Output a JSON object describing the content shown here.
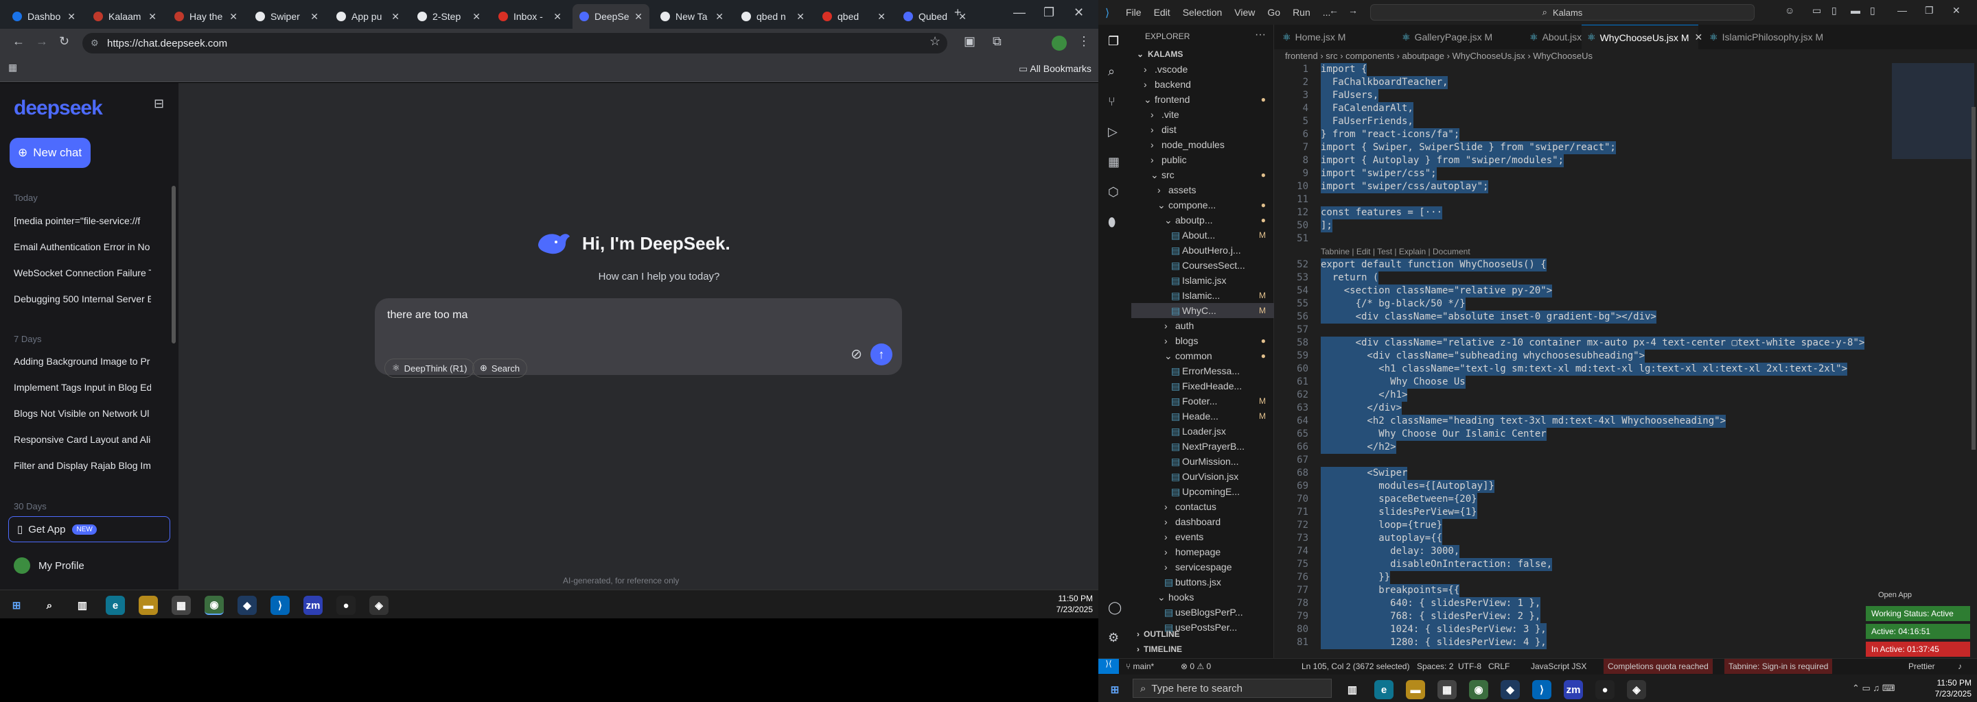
{
  "browser": {
    "tabs": [
      {
        "label": "Dashbo",
        "color": "#1a73e8"
      },
      {
        "label": "Kalaam",
        "color": "#c0392b"
      },
      {
        "label": "Hay the",
        "color": "#c0392b"
      },
      {
        "label": "Swiper",
        "color": "#e8eaed"
      },
      {
        "label": "App pu",
        "color": "#e8eaed"
      },
      {
        "label": "2-Step",
        "color": "#e8eaed"
      },
      {
        "label": "Inbox -",
        "color": "#d93025"
      },
      {
        "label": "DeepSe",
        "color": "#4d6bfe"
      },
      {
        "label": "New Ta",
        "color": "#e8eaed"
      },
      {
        "label": "qbed n",
        "color": "#e8eaed"
      },
      {
        "label": "qbed",
        "color": "#d93025"
      },
      {
        "label": "Qubed",
        "color": "#4d6bfe"
      }
    ],
    "url": "https://chat.deepseek.com",
    "all_bookmarks": "All Bookmarks"
  },
  "deepseek": {
    "logo": "deepseek",
    "new_chat": "New chat",
    "groups": {
      "today": "Today",
      "days7": "7 Days",
      "days30": "30 Days"
    },
    "history_today": [
      "[media pointer=\"file-service://f",
      "Email Authentication Error in No",
      "WebSocket Connection Failure Tr",
      "Debugging 500 Internal Server E"
    ],
    "history_7days": [
      "Adding Background Image to Pr",
      "Implement Tags Input in Blog Ed",
      "Blogs Not Visible on Network Ul",
      "Responsive Card Layout and Alig",
      "Filter and Display Rajab Blog Ima"
    ],
    "get_app": "Get App",
    "new_badge": "NEW",
    "profile": "My Profile",
    "greeting": "Hi, I'm DeepSeek.",
    "subtitle": "How can I help you today?",
    "input_value": "there are too ma",
    "deepthink": "DeepThink (R1)",
    "search": "Search",
    "footer": "AI-generated, for reference only"
  },
  "taskbar_left": {
    "time": "11:50 PM",
    "date": "7/23/2025"
  },
  "vscode": {
    "menu": [
      "File",
      "Edit",
      "Selection",
      "View",
      "Go",
      "Run",
      "..."
    ],
    "search": "Kalams",
    "explorer_title": "EXPLORER",
    "tree": [
      {
        "d": 0,
        "label": "KALAMS",
        "arrow": "⌄",
        "bold": true
      },
      {
        "d": 1,
        "label": ".vscode",
        "arrow": "›"
      },
      {
        "d": 1,
        "label": "backend",
        "arrow": "›"
      },
      {
        "d": 1,
        "label": "frontend",
        "arrow": "⌄",
        "mark": "●"
      },
      {
        "d": 2,
        "label": ".vite",
        "arrow": "›"
      },
      {
        "d": 2,
        "label": "dist",
        "arrow": "›"
      },
      {
        "d": 2,
        "label": "node_modules",
        "arrow": "›"
      },
      {
        "d": 2,
        "label": "public",
        "arrow": "›"
      },
      {
        "d": 2,
        "label": "src",
        "arrow": "⌄",
        "mark": "●"
      },
      {
        "d": 3,
        "label": "assets",
        "arrow": "›"
      },
      {
        "d": 3,
        "label": "compone...",
        "arrow": "⌄",
        "mark": "●"
      },
      {
        "d": 4,
        "label": "aboutp...",
        "arrow": "⌄",
        "mark": "●"
      },
      {
        "d": 5,
        "label": "About...",
        "mark": "M"
      },
      {
        "d": 5,
        "label": "AboutHero.j..."
      },
      {
        "d": 5,
        "label": "CoursesSect..."
      },
      {
        "d": 5,
        "label": "Islamic.jsx"
      },
      {
        "d": 5,
        "label": "Islamic...",
        "mark": "M"
      },
      {
        "d": 5,
        "label": "WhyC...",
        "mark": "M",
        "active": true
      },
      {
        "d": 4,
        "label": "auth",
        "arrow": "›"
      },
      {
        "d": 4,
        "label": "blogs",
        "arrow": "›",
        "mark": "●"
      },
      {
        "d": 4,
        "label": "common",
        "arrow": "⌄",
        "mark": "●"
      },
      {
        "d": 5,
        "label": "ErrorMessa..."
      },
      {
        "d": 5,
        "label": "FixedHeade..."
      },
      {
        "d": 5,
        "label": "Footer...",
        "mark": "M"
      },
      {
        "d": 5,
        "label": "Heade...",
        "mark": "M"
      },
      {
        "d": 5,
        "label": "Loader.jsx"
      },
      {
        "d": 5,
        "label": "NextPrayerB..."
      },
      {
        "d": 5,
        "label": "OurMission..."
      },
      {
        "d": 5,
        "label": "OurVision.jsx"
      },
      {
        "d": 5,
        "label": "UpcomingE..."
      },
      {
        "d": 4,
        "label": "contactus",
        "arrow": "›"
      },
      {
        "d": 4,
        "label": "dashboard",
        "arrow": "›"
      },
      {
        "d": 4,
        "label": "events",
        "arrow": "›"
      },
      {
        "d": 4,
        "label": "homepage",
        "arrow": "›"
      },
      {
        "d": 4,
        "label": "servicespage",
        "arrow": "›"
      },
      {
        "d": 4,
        "label": "buttons.jsx"
      },
      {
        "d": 3,
        "label": "hooks",
        "arrow": "⌄"
      },
      {
        "d": 4,
        "label": "useBlogsPerP..."
      },
      {
        "d": 4,
        "label": "usePostsPer..."
      }
    ],
    "outline": "OUTLINE",
    "timeline": "TIMELINE",
    "tabs": [
      "Home.jsx M",
      "GalleryPage.jsx M",
      "About.jsx",
      "WhyChooseUs.jsx M",
      "IslamicPhilosophy.jsx M"
    ],
    "breadcrumb": "frontend › src › components › aboutpage › WhyChooseUs.jsx › WhyChooseUs",
    "lines": [
      [
        "1",
        "import {"
      ],
      [
        "2",
        "  FaChalkboardTeacher,"
      ],
      [
        "3",
        "  FaUsers,"
      ],
      [
        "4",
        "  FaCalendarAlt,"
      ],
      [
        "5",
        "  FaUserFriends,"
      ],
      [
        "6",
        "} from \"react-icons/fa\";"
      ],
      [
        "7",
        "import { Swiper, SwiperSlide } from \"swiper/react\";"
      ],
      [
        "8",
        "import { Autoplay } from \"swiper/modules\";"
      ],
      [
        "9",
        "import \"swiper/css\";"
      ],
      [
        "10",
        "import \"swiper/css/autoplay\";"
      ],
      [
        "11",
        ""
      ],
      [
        "12",
        "const features = [···"
      ],
      [
        "50",
        "];"
      ],
      [
        "51",
        ""
      ],
      [
        "",
        "Tabnine | Edit | Test | Explain | Document"
      ],
      [
        "52",
        "export default function WhyChooseUs() {"
      ],
      [
        "53",
        "  return ("
      ],
      [
        "54",
        "    <section className=\"relative py-20\">"
      ],
      [
        "55",
        "      {/* bg-black/50 */}"
      ],
      [
        "56",
        "      <div className=\"absolute inset-0 gradient-bg\"></div>"
      ],
      [
        "57",
        ""
      ],
      [
        "58",
        "      <div className=\"relative z-10 container mx-auto px-4 text-center ▢text-white space-y-8\">"
      ],
      [
        "59",
        "        <div className=\"subheading whychoosesubheading\">"
      ],
      [
        "60",
        "          <h1 className=\"text-lg sm:text-xl md:text-xl lg:text-xl xl:text-xl 2xl:text-2xl\">"
      ],
      [
        "61",
        "            Why Choose Us"
      ],
      [
        "62",
        "          </h1>"
      ],
      [
        "63",
        "        </div>"
      ],
      [
        "64",
        "        <h2 className=\"heading text-3xl md:text-4xl Whychooseheading\">"
      ],
      [
        "65",
        "          Why Choose Our Islamic Center"
      ],
      [
        "66",
        "        </h2>"
      ],
      [
        "67",
        ""
      ],
      [
        "68",
        "        <Swiper"
      ],
      [
        "69",
        "          modules={[Autoplay]}"
      ],
      [
        "70",
        "          spaceBetween={20}"
      ],
      [
        "71",
        "          slidesPerView={1}"
      ],
      [
        "72",
        "          loop={true}"
      ],
      [
        "73",
        "          autoplay={{"
      ],
      [
        "74",
        "            delay: 3000,"
      ],
      [
        "75",
        "            disableOnInteraction: false,"
      ],
      [
        "76",
        "          }}"
      ],
      [
        "77",
        "          breakpoints={{"
      ],
      [
        "78",
        "            640: { slidesPerView: 1 },"
      ],
      [
        "79",
        "            768: { slidesPerView: 2 },"
      ],
      [
        "80",
        "            1024: { slidesPerView: 3 },"
      ],
      [
        "81",
        "            1280: { slidesPerView: 4 },"
      ]
    ],
    "status": {
      "branch": "main*",
      "errors": "⊗ 0 ⚠ 0",
      "pos": "Ln 105, Col 2 (3672 selected)",
      "spaces": "Spaces: 2",
      "enc": "UTF-8",
      "eol": "CRLF",
      "lang": "JavaScript JSX",
      "quota": "Completions quota reached",
      "tabnine": "Tabnine: Sign-in is required",
      "prettier": "Prettier"
    },
    "open_app": "Open App",
    "working": "Working Status: Active",
    "active": "Active: 04:16:51",
    "inactive": "In Active: 01:37:45",
    "taskbar_search": "Type here to search",
    "time": "11:50 PM",
    "date": "7/23/2025"
  }
}
